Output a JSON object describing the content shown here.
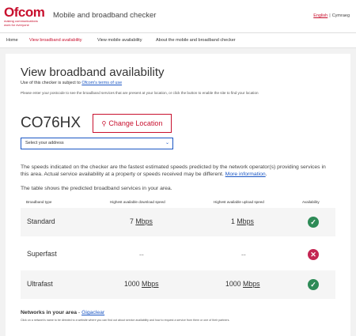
{
  "header": {
    "logo_text": "Ofcom",
    "logo_tagline": "making communications work for everyone",
    "app_title": "Mobile and broadband checker",
    "lang_english": "English",
    "lang_separator": "|",
    "lang_cymraeg": "Cymraeg"
  },
  "nav": {
    "home": "Home",
    "broadband": "View broadband availability",
    "mobile": "View mobile availability",
    "about": "About the mobile and broadband checker"
  },
  "page": {
    "title": "View broadband availability",
    "terms_prefix": "Use of this checker is subject to ",
    "terms_link": "Ofcom's terms of use",
    "hint": "Please enter your postcode to see the broadband services that are present at your location, or click the button to enable the site to find your location",
    "postcode": "CO76HX",
    "change_location": "Change Location",
    "select_address": "Select your address",
    "info_text": "The speeds indicated on the checker are the fastest estimated speeds predicted by the network operator(s) providing services in this area. Actual service availability at a property or speeds received may be different. ",
    "info_link": "More information",
    "info_end": ".",
    "table_intro": "The table shows the predicted broadband services in your area."
  },
  "table": {
    "headers": [
      "Broadband type",
      "Highest available download speed",
      "Highest available upload speed",
      "Availability"
    ],
    "rows": [
      {
        "type": "Standard",
        "download": "7",
        "download_unit": "Mbps",
        "upload": "1",
        "upload_unit": "Mbps",
        "available": true
      },
      {
        "type": "Superfast",
        "download": "--",
        "download_unit": "",
        "upload": "--",
        "upload_unit": "",
        "available": false
      },
      {
        "type": "Ultrafast",
        "download": "1000",
        "download_unit": "Mbps",
        "upload": "1000",
        "upload_unit": "Mbps",
        "available": true
      }
    ]
  },
  "networks": {
    "label": "Networks in your area",
    "dash": " - ",
    "provider": "Gigaclear",
    "note": "Click on a network's name to be directed to a website where you can find out about service availability and how to request a service from them or one of their partners."
  },
  "colors": {
    "brand": "#c8102e",
    "link": "#1a56c4",
    "available": "#2e8b57",
    "unavailable": "#c42552"
  }
}
